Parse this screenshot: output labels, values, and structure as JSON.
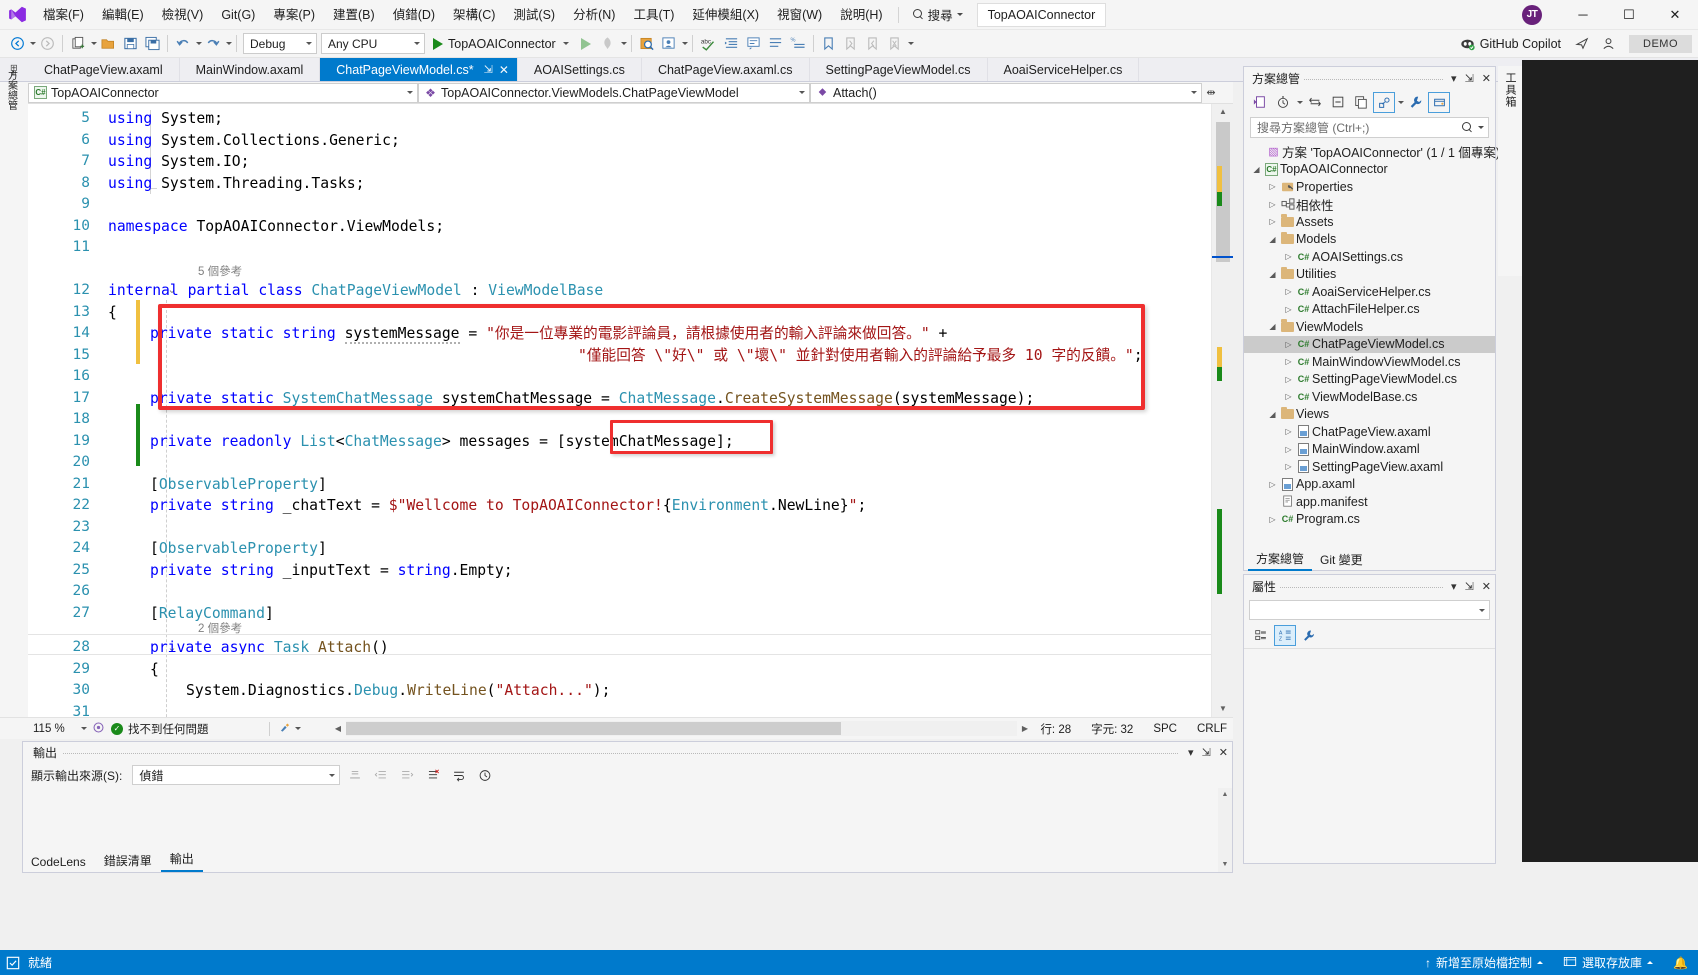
{
  "titlebar": {
    "logo_icon": "visual-studio-logo",
    "menus": [
      {
        "label": "檔案(F)"
      },
      {
        "label": "編輯(E)"
      },
      {
        "label": "檢視(V)"
      },
      {
        "label": "Git(G)"
      },
      {
        "label": "專案(P)"
      },
      {
        "label": "建置(B)"
      },
      {
        "label": "偵錯(D)"
      },
      {
        "label": "架構(C)"
      },
      {
        "label": "測試(S)"
      },
      {
        "label": "分析(N)"
      },
      {
        "label": "工具(T)"
      },
      {
        "label": "延伸模組(X)"
      },
      {
        "label": "視窗(W)"
      },
      {
        "label": "說明(H)"
      }
    ],
    "search_label": "搜尋",
    "solution_name": "TopAOAIConnector",
    "avatar_initials": "JT",
    "window_buttons": {
      "minimize": "─",
      "maximize": "☐",
      "close": "✕"
    }
  },
  "toolbar": {
    "back_icon": "navigate-back-icon",
    "forward_icon": "navigate-forward-icon",
    "new_project_icon": "new-project-icon",
    "open_file_icon": "open-file-icon",
    "save_icon": "save-icon",
    "save_all_icon": "save-all-icon",
    "undo_icon": "undo-icon",
    "redo_icon": "redo-icon",
    "config_value": "Debug",
    "platform_value": "Any CPU",
    "run_label": "TopAOAIConnector",
    "start_icon": "start-debug-icon",
    "start_no_debug_icon": "start-without-debugging-icon",
    "hot_reload_icon": "hot-reload-icon",
    "search_tool_icon": "find-icon",
    "live_share_icon": "live-share-icon",
    "spell_icon": "spell-check-icon",
    "indent_icon": "indent-icon",
    "comment_icon": "comment-icon",
    "outdent_icon": "outdent-icon",
    "bookmark_icon": "bookmark-icon",
    "prev_bookmark_icon": "previous-bookmark-icon",
    "next_bookmark_icon": "next-bookmark-icon",
    "clear_bookmark_icon": "clear-bookmarks-icon",
    "copilot_label": "GitHub Copilot",
    "copilot_icon": "copilot-icon",
    "feedback_icon": "send-feedback-icon",
    "account_icon": "account-icon",
    "demo_badge": "DEMO"
  },
  "tabs": {
    "gutter_glyph": "tab-overflow-glyph",
    "items": [
      {
        "label": "ChatPageView.axaml",
        "active": false
      },
      {
        "label": "MainWindow.axaml",
        "active": false
      },
      {
        "label": "ChatPageViewModel.cs*",
        "active": true,
        "pin": "⇲",
        "close": "✕"
      },
      {
        "label": "AOAISettings.cs",
        "active": false
      },
      {
        "label": "ChatPageView.axaml.cs",
        "active": false
      },
      {
        "label": "SettingPageViewModel.cs",
        "active": false
      },
      {
        "label": "AoaiServiceHelper.cs",
        "active": false
      }
    ],
    "overflow_icon": "tab-list-icon",
    "settings_icon": "tab-settings-icon"
  },
  "navbar": {
    "project": "TopAOAIConnector",
    "project_icon": "csharp-project-icon",
    "type": "TopAOAIConnector.ViewModels.ChatPageViewModel",
    "type_icon": "class-icon",
    "member": "Attach()",
    "member_icon": "method-icon",
    "split_icon": "split-editor-icon"
  },
  "editor": {
    "lines": [
      {
        "num": "5",
        "text": "using System;"
      },
      {
        "num": "6",
        "text": "using System.Collections.Generic;"
      },
      {
        "num": "7",
        "text": "using System.IO;"
      },
      {
        "num": "8",
        "text": "using System.Threading.Tasks;"
      },
      {
        "num": "9",
        "text": ""
      },
      {
        "num": "10",
        "text": "namespace TopAOAIConnector.ViewModels;"
      },
      {
        "num": "11",
        "text": ""
      },
      {
        "num": "12",
        "text": "internal partial class ChatPageViewModel : ViewModelBase"
      },
      {
        "num": "13",
        "text": "{"
      },
      {
        "num": "14",
        "text": "    private static string systemMessage = \"你是一位專業的電影評論員，請根據使用者的輸入評論來做回答。\" +"
      },
      {
        "num": "15",
        "text": "                    \"僅能回答 \\\"好\\\" 或 \\\"壞\\\" 並針對使用者輸入的評論給予最多 10 字的反饋。\";"
      },
      {
        "num": "16",
        "text": ""
      },
      {
        "num": "17",
        "text": "    private static SystemChatMessage systemChatMessage = ChatMessage.CreateSystemMessage(systemMessage);"
      },
      {
        "num": "18",
        "text": ""
      },
      {
        "num": "19",
        "text": "    private readonly List<ChatMessage> messages = [systemChatMessage];"
      },
      {
        "num": "20",
        "text": ""
      },
      {
        "num": "21",
        "text": "    [ObservableProperty]"
      },
      {
        "num": "22",
        "text": "    private string _chatText = $\"Wellcome to TopAOAIConnector!{Environment.NewLine}\";"
      },
      {
        "num": "23",
        "text": ""
      },
      {
        "num": "24",
        "text": "    [ObservableProperty]"
      },
      {
        "num": "25",
        "text": "    private string _inputText = string.Empty;"
      },
      {
        "num": "26",
        "text": ""
      },
      {
        "num": "27",
        "text": "    [RelayCommand]"
      },
      {
        "num": "28",
        "text": "    private async Task Attach()"
      },
      {
        "num": "29",
        "text": "    {"
      },
      {
        "num": "30",
        "text": "        System.Diagnostics.Debug.WriteLine(\"Attach...\");"
      },
      {
        "num": "31",
        "text": ""
      }
    ],
    "codelens_class": "5 個參考",
    "codelens_attach": "2 個參考",
    "annotation_boxes": [
      {
        "name": "system-message-highlight"
      },
      {
        "name": "system-chat-message-highlight"
      }
    ]
  },
  "editor_status": {
    "zoom": "115 %",
    "issues": "找不到任何問題",
    "line_label": "行: 28",
    "col_label": "字元: 32",
    "spaces": "SPC",
    "eol": "CRLF"
  },
  "output": {
    "title": "輸出",
    "source_label": "顯示輸出來源(S):",
    "source_value": "偵錯",
    "buttons": [
      {
        "icon": "clear-output-icon"
      },
      {
        "icon": "goto-previous-icon"
      },
      {
        "icon": "goto-next-icon"
      },
      {
        "icon": "clear-all-icon"
      },
      {
        "icon": "word-wrap-icon"
      },
      {
        "icon": "timestamp-icon"
      }
    ],
    "body_text": ""
  },
  "bottom_tabs": [
    {
      "label": "CodeLens",
      "active": false
    },
    {
      "label": "錯誤清單",
      "active": false
    },
    {
      "label": "輸出",
      "active": true
    }
  ],
  "solution_explorer": {
    "title": "方案總管",
    "search_placeholder": "搜尋方案總管 (Ctrl+;)",
    "toolbar": [
      {
        "icon": "pending-changes-icon"
      },
      {
        "icon": "history-icon"
      },
      {
        "icon": "sync-icon"
      },
      {
        "icon": "collapse-all-icon"
      },
      {
        "icon": "show-all-files-icon"
      },
      {
        "icon": "properties-view-icon"
      },
      {
        "icon": "wrench-icon"
      },
      {
        "icon": "preview-selected-icon"
      }
    ],
    "tree": [
      {
        "label": "方案 'TopAOAIConnector' (1 / 1 個專案)",
        "depth": 0,
        "arrow": "",
        "icon": "solution-icon"
      },
      {
        "label": "TopAOAIConnector",
        "depth": 1,
        "arrow": "◢",
        "icon": "csharp-project-icon"
      },
      {
        "label": "Properties",
        "depth": 2,
        "arrow": "▷",
        "icon": "properties-icon"
      },
      {
        "label": "相依性",
        "depth": 2,
        "arrow": "▷",
        "icon": "dependencies-icon"
      },
      {
        "label": "Assets",
        "depth": 2,
        "arrow": "▷",
        "icon": "folder-icon"
      },
      {
        "label": "Models",
        "depth": 2,
        "arrow": "◢",
        "icon": "folder-icon"
      },
      {
        "label": "AOAISettings.cs",
        "depth": 3,
        "arrow": "▷",
        "icon": "csharp-file-icon"
      },
      {
        "label": "Utilities",
        "depth": 2,
        "arrow": "◢",
        "icon": "folder-icon"
      },
      {
        "label": "AoaiServiceHelper.cs",
        "depth": 3,
        "arrow": "▷",
        "icon": "csharp-file-icon"
      },
      {
        "label": "AttachFileHelper.cs",
        "depth": 3,
        "arrow": "▷",
        "icon": "csharp-file-icon"
      },
      {
        "label": "ViewModels",
        "depth": 2,
        "arrow": "◢",
        "icon": "folder-icon"
      },
      {
        "label": "ChatPageViewModel.cs",
        "depth": 3,
        "arrow": "▷",
        "icon": "csharp-file-icon",
        "selected": true
      },
      {
        "label": "MainWindowViewModel.cs",
        "depth": 3,
        "arrow": "▷",
        "icon": "csharp-file-icon"
      },
      {
        "label": "SettingPageViewModel.cs",
        "depth": 3,
        "arrow": "▷",
        "icon": "csharp-file-icon"
      },
      {
        "label": "ViewModelBase.cs",
        "depth": 3,
        "arrow": "▷",
        "icon": "csharp-file-icon"
      },
      {
        "label": "Views",
        "depth": 2,
        "arrow": "◢",
        "icon": "folder-icon"
      },
      {
        "label": "ChatPageView.axaml",
        "depth": 3,
        "arrow": "▷",
        "icon": "xaml-file-icon"
      },
      {
        "label": "MainWindow.axaml",
        "depth": 3,
        "arrow": "▷",
        "icon": "xaml-file-icon"
      },
      {
        "label": "SettingPageView.axaml",
        "depth": 3,
        "arrow": "▷",
        "icon": "xaml-file-icon"
      },
      {
        "label": "App.axaml",
        "depth": 2,
        "arrow": "▷",
        "icon": "xaml-file-icon"
      },
      {
        "label": "app.manifest",
        "depth": 2,
        "arrow": "",
        "icon": "manifest-file-icon"
      },
      {
        "label": "Program.cs",
        "depth": 2,
        "arrow": "▷",
        "icon": "csharp-file-icon"
      }
    ],
    "tabs": [
      {
        "label": "方案總管",
        "active": true
      },
      {
        "label": "Git 變更",
        "active": false
      }
    ]
  },
  "properties_panel": {
    "title": "屬性",
    "toolbar": [
      {
        "icon": "categorized-icon"
      },
      {
        "icon": "alphabetical-icon"
      },
      {
        "icon": "property-pages-icon"
      }
    ],
    "combo_value": ""
  },
  "right_dock": {
    "toolbox_label": "工具箱"
  },
  "left_dock": {
    "label": "方案總管"
  },
  "statusbar": {
    "ready": "就緒",
    "ready_icon": "ready-icon",
    "add_source_control": "新增至原始檔控制",
    "add_source_control_icon": "source-control-icon",
    "select_repo": "選取存放庫",
    "select_repo_icon": "repository-icon",
    "notifications_icon": "bell-icon"
  }
}
